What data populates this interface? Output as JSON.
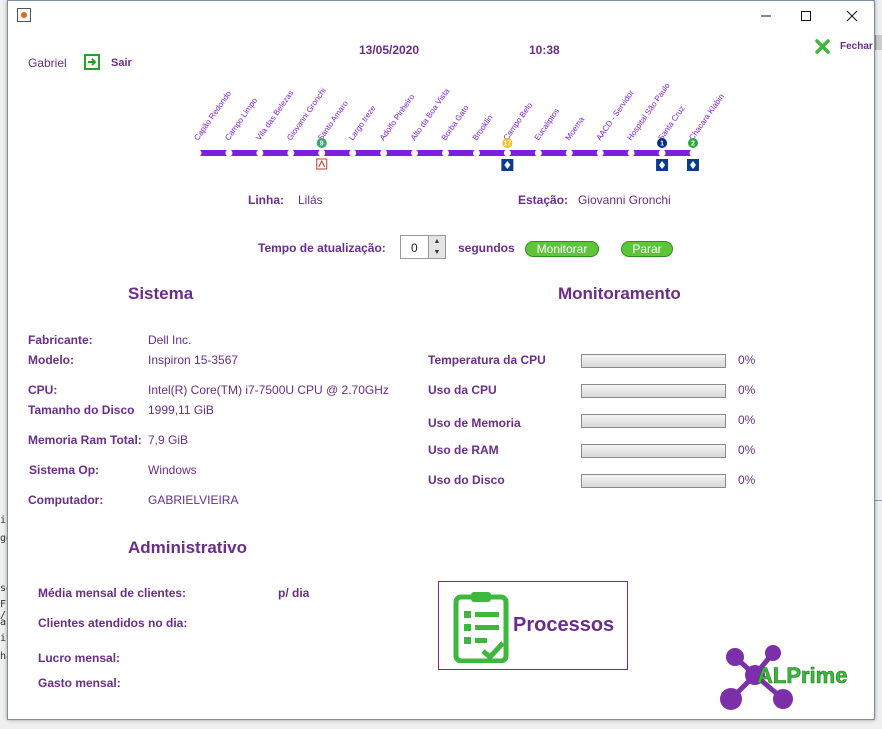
{
  "header": {
    "user": "Gabriel",
    "logout": "Sair",
    "date": "13/05/2020",
    "time": "10:38",
    "close": "Fechar"
  },
  "metro": {
    "line_color": "#7b1fe0",
    "stations": [
      {
        "name": "Capão Redondo",
        "badge": "",
        "conn": ""
      },
      {
        "name": "Campo Limpo",
        "badge": "",
        "conn": ""
      },
      {
        "name": "Vila das Belezas",
        "badge": "",
        "conn": ""
      },
      {
        "name": "Giovanni Gronchi",
        "badge": "",
        "conn": ""
      },
      {
        "name": "Santo Amaro",
        "badge": "9",
        "conn": "rail"
      },
      {
        "name": "Largo treze",
        "badge": "",
        "conn": ""
      },
      {
        "name": "Adolfo Pinheiro",
        "badge": "",
        "conn": ""
      },
      {
        "name": "Alto da Boa Vista",
        "badge": "",
        "conn": ""
      },
      {
        "name": "Borba Gato",
        "badge": "",
        "conn": ""
      },
      {
        "name": "Brooklin",
        "badge": "",
        "conn": ""
      },
      {
        "name": "Campo Belo",
        "badge": "17",
        "conn": "transfer"
      },
      {
        "name": "Eucaliptos",
        "badge": "",
        "conn": ""
      },
      {
        "name": "Moema",
        "badge": "",
        "conn": ""
      },
      {
        "name": "AACD - Servidor",
        "badge": "",
        "conn": ""
      },
      {
        "name": "Hospital São Paulo",
        "badge": "",
        "conn": ""
      },
      {
        "name": "Santa Cruz",
        "badge": "1",
        "conn": "transfer"
      },
      {
        "name": "Chacara Klabin",
        "badge": "2",
        "conn": "transfer"
      }
    ],
    "badge_colors": {
      "9": "#3aa66a",
      "17": "#f0c020",
      "1": "#0a2a8a",
      "2": "#2aa83a"
    }
  },
  "line_info": {
    "line_label": "Linha:",
    "line_value": "Lilás",
    "station_label": "Estação:",
    "station_value": "Giovanni Gronchi"
  },
  "refresh": {
    "label": "Tempo de atualização:",
    "value": "0",
    "unit": "segundos",
    "monitor": "Monitorar",
    "stop": "Parar"
  },
  "sistema": {
    "title": "Sistema",
    "rows": [
      {
        "label": "Fabricante:",
        "value": "Dell Inc."
      },
      {
        "label": "Modelo:",
        "value": "Inspiron 15-3567"
      },
      {
        "label": "CPU:",
        "value": "Intel(R) Core(TM) i7-7500U CPU @ 2.70GHz"
      },
      {
        "label": "Tamanho do Disco",
        "value": "1999,11 GiB"
      },
      {
        "label": "Memoria Ram Total:",
        "value": "7,9 GiB"
      },
      {
        "label": "Sistema Op:",
        "value": "Windows"
      },
      {
        "label": "Computador:",
        "value": "GABRIELVIEIRA"
      }
    ]
  },
  "monitoramento": {
    "title": "Monitoramento",
    "rows": [
      {
        "label": "Temperatura da CPU",
        "value": "0%",
        "fraction": 0
      },
      {
        "label": "Uso da CPU",
        "value": "0%",
        "fraction": 0
      },
      {
        "label": "Uso de Memoria",
        "value": "0%",
        "fraction": 0
      },
      {
        "label": "Uso de RAM",
        "value": "0%",
        "fraction": 0
      },
      {
        "label": "Uso do Disco",
        "value": "0%",
        "fraction": 0
      }
    ]
  },
  "administrativo": {
    "title": "Administrativo",
    "monthly_clients": "Média mensal de clientes:",
    "per_day": "p/ dia",
    "clients_today": "Clientes atendidos no dia:",
    "monthly_profit": "Lucro mensal:",
    "monthly_expense": "Gasto mensal:"
  },
  "processos": {
    "label": "Processos"
  },
  "logo": {
    "text": "ALPrime"
  },
  "background_text": [
    "ic",
    "ge",
    "se",
    "F /",
    "ar",
    "iv",
    "ha"
  ]
}
